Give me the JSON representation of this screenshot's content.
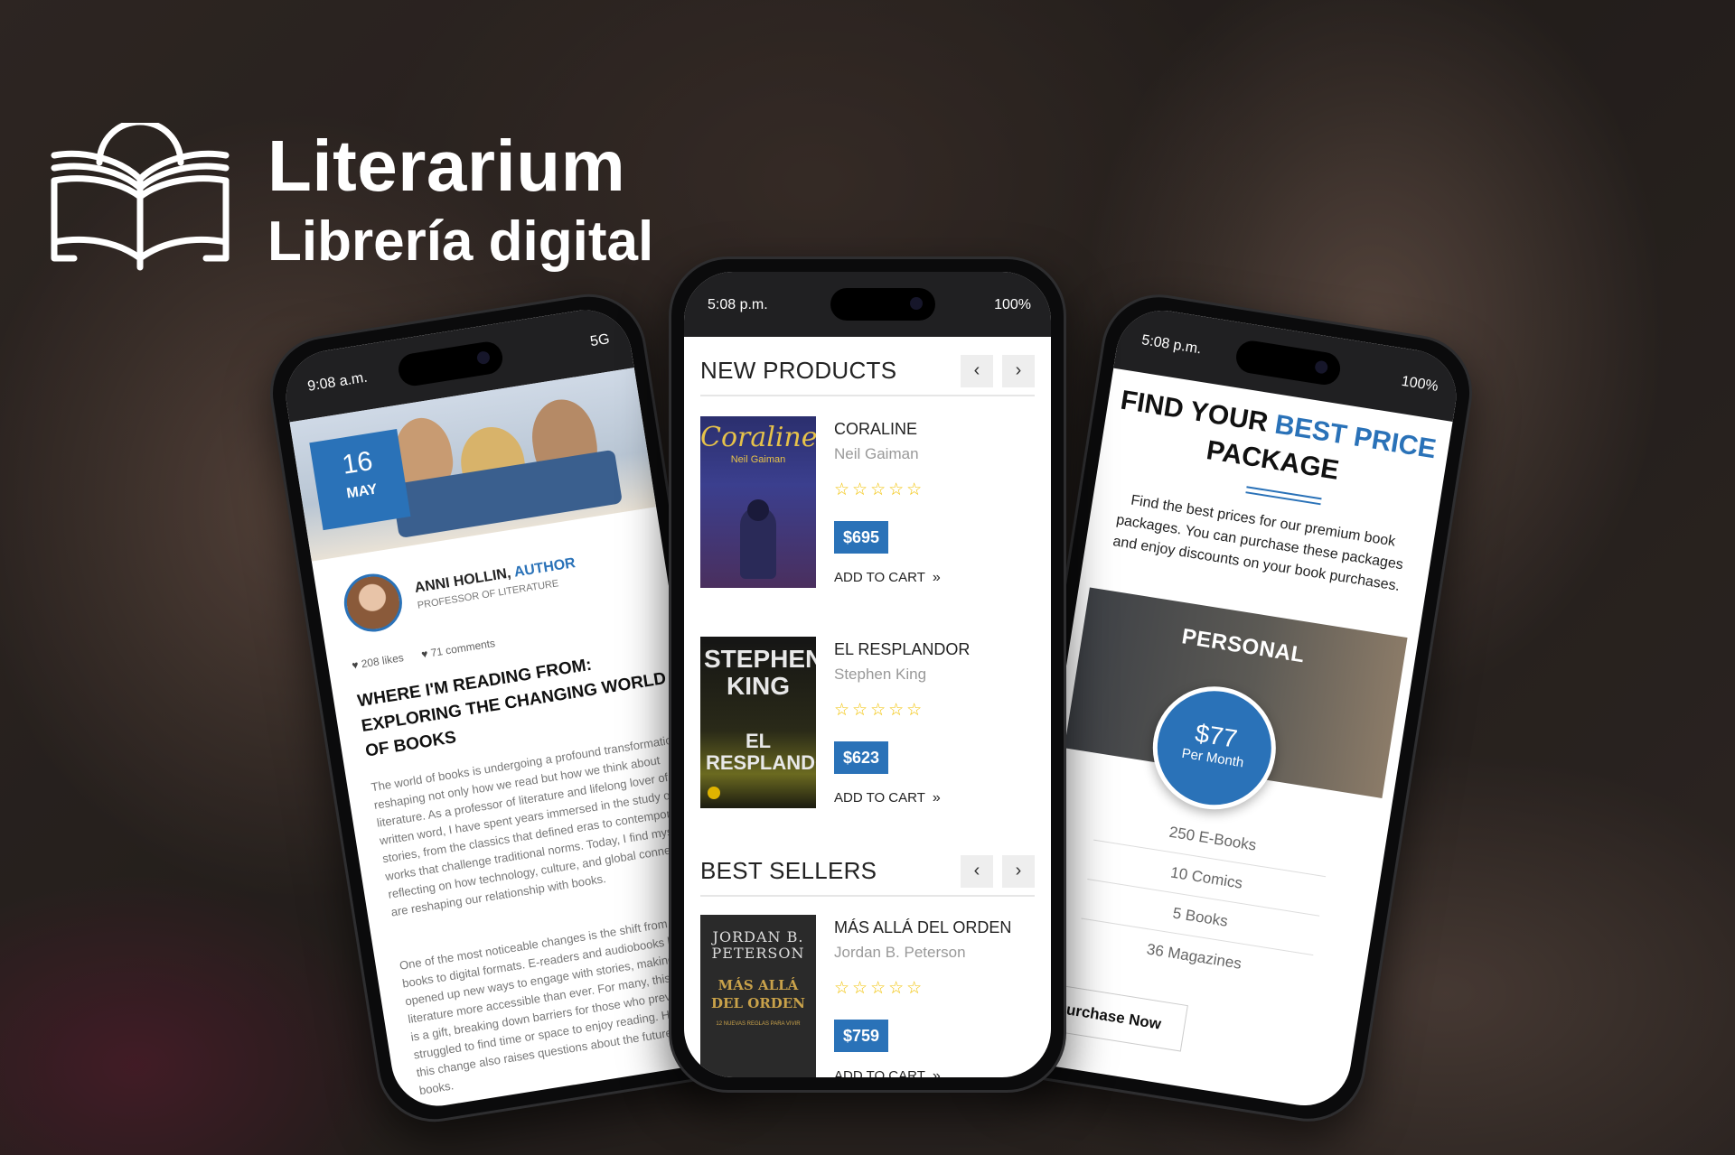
{
  "brand": {
    "title": "Literarium",
    "subtitle": "Librería digital"
  },
  "colors": {
    "accent": "#2a72b8",
    "star": "#f2c200",
    "statusbar": "#202022"
  },
  "phone_left": {
    "status_time": "9:08 a.m.",
    "status_right": "5G",
    "date_day": "16",
    "date_month": "MAY",
    "author_name": "ANNI HOLLIN,",
    "author_role": "AUTHOR",
    "author_title": "PROFESSOR OF LITERATURE",
    "likes": "208 likes",
    "comments": "71 comments",
    "post_title": "WHERE I'M READING FROM: EXPLORING THE CHANGING WORLD OF BOOKS",
    "paragraph_1": "The world of books is undergoing a profound transformation, reshaping not only how we read but how we think about literature. As a professor of literature and lifelong lover of the written word, I have spent years immersed in the study of stories, from the classics that defined eras to contemporary works that challenge traditional norms. Today, I find myself reflecting on how technology, culture, and global connectivity are reshaping our relationship with books.",
    "paragraph_2": "One of the most noticeable changes is the shift from physical books to digital formats. E-readers and audiobooks have opened up new ways to engage with stories, making literature more accessible than ever. For many, this evolution is a gift, breaking down barriers for those who previously struggled to find time or space to enjoy reading. However, this change also raises questions about the future of printed books."
  },
  "phone_center": {
    "status_time": "5:08 p.m.",
    "status_right": "100%",
    "new_products_title": "NEW PRODUCTS",
    "best_sellers_title": "BEST SELLERS",
    "prev_icon": "‹",
    "next_icon": "›",
    "add_to_cart": "ADD TO CART",
    "stars": "☆☆☆☆☆",
    "products": [
      {
        "title": "CORALINE",
        "author": "Neil Gaiman",
        "price": "$695",
        "cover_title": "Coraline",
        "cover_author": "Neil Gaiman"
      },
      {
        "title": "EL RESPLANDOR",
        "author": "Stephen King",
        "price": "$623",
        "cover_title": "STEPHEN KING",
        "cover_sub": "EL RESPLANDOR"
      },
      {
        "title": "MÁS ALLÁ DEL ORDEN",
        "author": "Jordan B. Peterson",
        "price": "$759",
        "cover_title": "JORDAN B. PETERSON",
        "cover_sub": "MÁS ALLÁ DEL ORDEN",
        "cover_tag": "12 NUEVAS REGLAS PARA VIVIR"
      }
    ]
  },
  "phone_right": {
    "status_time": "5:08 p.m.",
    "status_right": "100%",
    "heading_1": "FIND YOUR",
    "heading_blue": "BEST PRICE",
    "heading_2": "PACKAGE",
    "description": "Find the best prices for our premium book packages. You can purchase these packages and enjoy discounts on your book purchases.",
    "plan_name": "PERSONAL",
    "price": "$77",
    "period": "Per Month",
    "features": [
      "250 E-Books",
      "10 Comics",
      "5 Books",
      "36 Magazines"
    ],
    "button": "Purchase Now"
  }
}
